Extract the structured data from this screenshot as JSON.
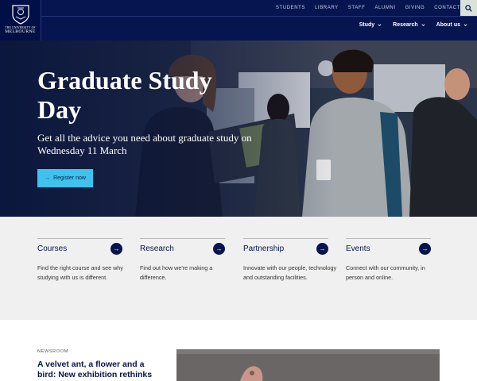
{
  "header": {
    "logo": {
      "line1": "THE UNIVERSITY OF",
      "line2": "MELBOURNE",
      "icon": "university-crest-icon"
    },
    "utility_links": [
      "STUDENTS",
      "LIBRARY",
      "STAFF",
      "ALUMNI",
      "GIVING",
      "CONTACT"
    ],
    "search_icon": "search-icon",
    "main_nav": [
      {
        "label": "Study",
        "icon": "chevron-down-icon"
      },
      {
        "label": "Research",
        "icon": "chevron-down-icon"
      },
      {
        "label": "About us",
        "icon": "chevron-down-icon"
      }
    ],
    "colors": {
      "navy": "#061550",
      "search_bg": "#dbe2dc"
    }
  },
  "hero": {
    "title": "Graduate Study Day",
    "subtitle": "Get all the advice you need about graduate study on Wednesday 11 March",
    "cta_label": "Register now",
    "cta_icon": "arrow-right-icon",
    "colors": {
      "cta_bg": "#3fc2ec"
    }
  },
  "quick_links": [
    {
      "title": "Courses",
      "description": "Find the right course and see why studying with us is different."
    },
    {
      "title": "Research",
      "description": "Find out how we're making a difference."
    },
    {
      "title": "Partnership",
      "description": "Innovate with our people, technology and outstanding facilities."
    },
    {
      "title": "Events",
      "description": "Connect with our community, in person and online."
    }
  ],
  "newsroom": {
    "label": "NEWSROOM",
    "headline": "A velvet ant, a flower and a bird: New exhibition rethinks nature"
  }
}
